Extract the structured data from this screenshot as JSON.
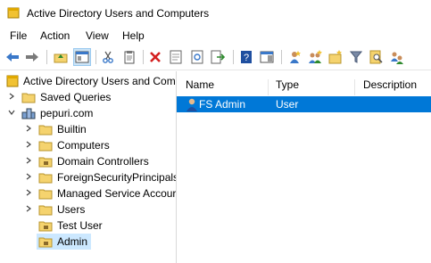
{
  "window": {
    "title": "Active Directory Users and Computers"
  },
  "menu": {
    "file": "File",
    "action": "Action",
    "view": "View",
    "help": "Help"
  },
  "tree": {
    "root": "Active Directory Users and Com",
    "saved_queries": "Saved Queries",
    "domain": "pepuri.com",
    "children": [
      "Builtin",
      "Computers",
      "Domain Controllers",
      "ForeignSecurityPrincipals",
      "Managed Service Accour",
      "Users",
      "Test User",
      "Admin"
    ]
  },
  "list": {
    "columns": [
      "Name",
      "Type",
      "Description"
    ],
    "rows": [
      {
        "name": "FS Admin",
        "type": "User",
        "description": ""
      }
    ]
  },
  "colors": {
    "selection": "#0078d7",
    "tree_selection": "#cce8ff",
    "folder": "#f5d36e"
  }
}
